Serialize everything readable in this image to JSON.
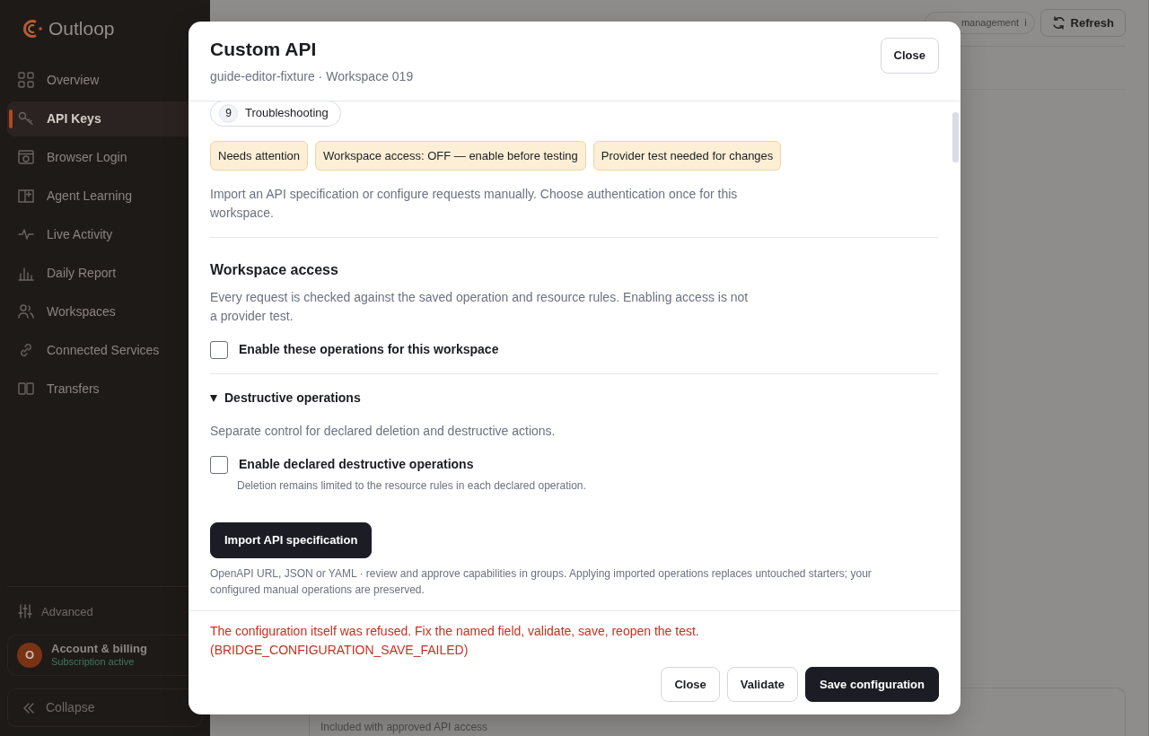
{
  "sidebar": {
    "brand": "Outloop",
    "items": [
      {
        "label": "Overview",
        "selected": false
      },
      {
        "label": "API Keys",
        "selected": true
      },
      {
        "label": "Browser Login",
        "selected": false
      },
      {
        "label": "Agent Learning",
        "selected": false
      },
      {
        "label": "Live Activity",
        "selected": false
      },
      {
        "label": "Daily Report",
        "selected": false
      },
      {
        "label": "Workspaces",
        "selected": false
      },
      {
        "label": "Connected Services",
        "selected": false
      },
      {
        "label": "Transfers",
        "selected": false
      }
    ],
    "advanced": "Advanced",
    "account": {
      "avatar": "O",
      "name": "Account & billing",
      "status": "Subscription active"
    },
    "collapse": "Collapse"
  },
  "background": {
    "pill": "management",
    "pill_icon": "i",
    "refresh": "Refresh",
    "row_text": "Included with approved API access"
  },
  "modal": {
    "title": "Custom API",
    "subtitle": "guide-editor-fixture · Workspace 019",
    "close": "Close",
    "step": {
      "number": "9",
      "label": "Troubleshooting"
    },
    "badges": [
      "Needs attention",
      "Workspace access: OFF — enable before testing",
      "Provider test needed for changes"
    ],
    "intro": "Import an API specification or configure requests manually. Choose authentication once for this workspace.",
    "access": {
      "heading": "Workspace access",
      "text": "Every request is checked against the saved operation and resource rules. Enabling access is not a provider test.",
      "checkbox": {
        "label": "Enable these operations for this workspace",
        "checked": false
      }
    },
    "destructive": {
      "summary": "Destructive operations",
      "expanded": true,
      "text": "Separate control for declared deletion and destructive actions.",
      "checkbox": {
        "label": "Enable declared destructive operations",
        "checked": false,
        "help": "Deletion remains limited to the resource rules in each declared operation."
      }
    },
    "import": {
      "button": "Import API specification",
      "text": "OpenAPI URL, JSON or YAML · review and approve capabilities in groups. Applying imported operations replaces untouched starters; your configured manual operations are preserved."
    },
    "footer": {
      "error": "The configuration itself was refused. Fix the named field, validate, save, reopen the test. (BRIDGE_CONFIGURATION_SAVE_FAILED)",
      "buttons": [
        {
          "label": "Close",
          "kind": "outline"
        },
        {
          "label": "Validate",
          "kind": "outline"
        },
        {
          "label": "Save configuration",
          "kind": "primary"
        }
      ]
    }
  }
}
